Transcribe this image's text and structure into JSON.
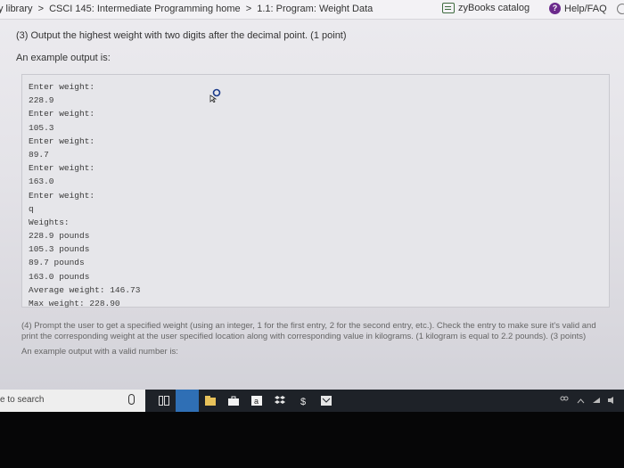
{
  "breadcrumb": {
    "items": [
      "My library",
      "CSCI 145: Intermediate Programming home",
      "1.1: Program: Weight Data"
    ],
    "separator": ">"
  },
  "header_links": {
    "zybooks_catalog": "zyBooks catalog",
    "help": "Help/FAQ"
  },
  "instruction_3": "(3) Output the highest weight with two digits after the decimal point. (1 point)",
  "example_label": "An example output is:",
  "code_lines": [
    "Enter weight:",
    "228.9",
    "Enter weight:",
    "105.3",
    "Enter weight:",
    "89.7",
    "Enter weight:",
    "163.0",
    "Enter weight:",
    "q",
    "Weights:",
    "228.9 pounds",
    "105.3 pounds",
    "89.7 pounds",
    "163.0 pounds",
    "Average weight: 146.73",
    "Max weight: 228.90"
  ],
  "section_4": {
    "text": "(4) Prompt the user to get a specified weight (using an integer, 1 for the first entry, 2 for the second entry, etc.). Check the entry to make sure it's valid and print the corresponding weight at the user specified location along with corresponding value in kilograms. (1 kilogram is equal to 2.2 pounds). (3 points)",
    "example_label": "An example output with a valid number is:"
  },
  "taskbar": {
    "search_placeholder": "Type here to search",
    "search_visible": "e to search",
    "apps": [
      "task-view",
      "active-app",
      "files",
      "store",
      "amazon",
      "dropbox",
      "dollar",
      "outlook"
    ]
  },
  "colors": {
    "help_icon": "#6b2a8c",
    "taskbar": "#1e2228",
    "active_app": "#2f6fb5",
    "zybooks_icon": "#3f6b3f"
  }
}
